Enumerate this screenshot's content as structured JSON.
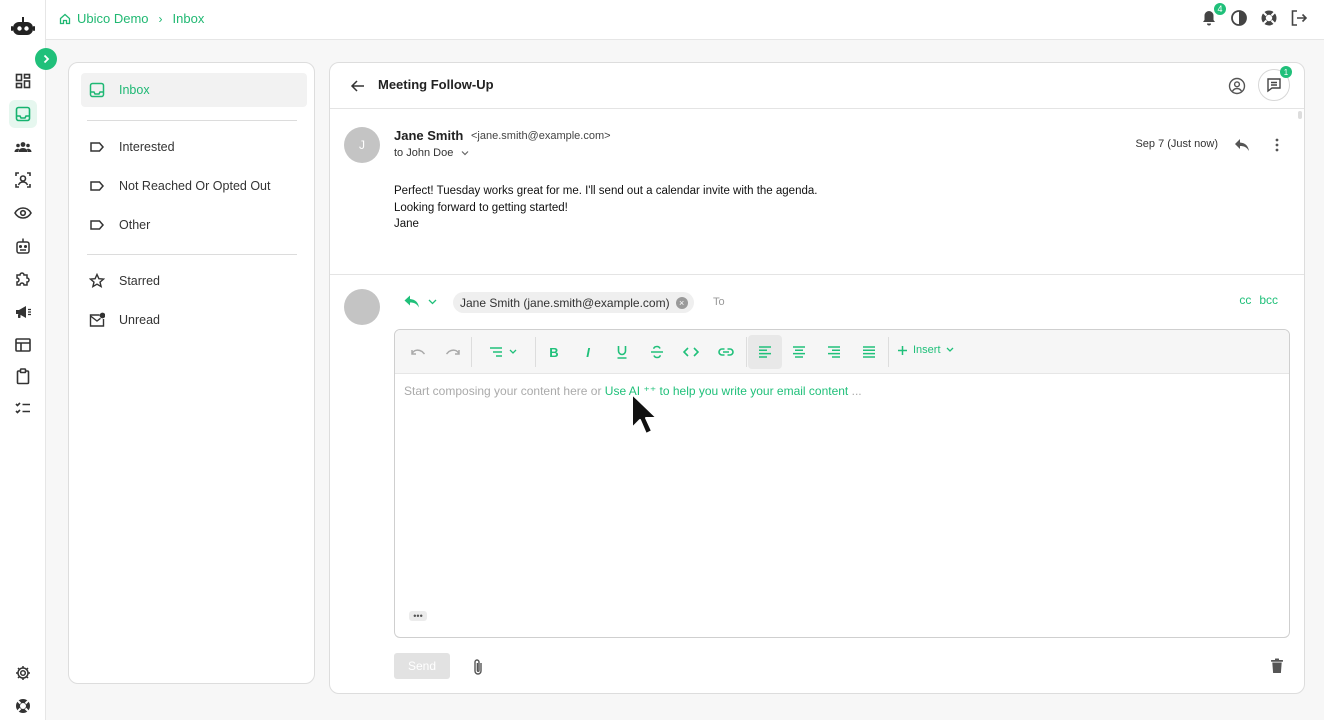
{
  "breadcrumb": {
    "workspace": "Ubico Demo",
    "current": "Inbox"
  },
  "notifications": {
    "count": "4"
  },
  "sidebar_icons": [
    "dashboard-icon",
    "inbox-icon",
    "contacts-icon",
    "prospects-icon",
    "eye-icon",
    "robot-icon",
    "extension-icon",
    "megaphone-icon",
    "table-icon",
    "clipboard-icon",
    "checklist-icon",
    "gear-icon",
    "lifebuoy-icon"
  ],
  "folders": {
    "inbox": "Inbox",
    "interested": "Interested",
    "not_reached": "Not Reached Or Opted Out",
    "other": "Other",
    "starred": "Starred",
    "unread": "Unread"
  },
  "thread": {
    "subject": "Meeting Follow-Up",
    "chat_badge": "1",
    "message": {
      "avatar_initial": "J",
      "sender_name": "Jane Smith",
      "sender_email": "<jane.smith@example.com>",
      "to": "to John Doe",
      "date": "Sep 7 (Just now)",
      "body": [
        "Perfect! Tuesday works great for me. I'll send out a calendar invite with the agenda.",
        "Looking forward to getting started!",
        "Jane"
      ]
    }
  },
  "compose": {
    "recipient": "Jane Smith (jane.smith@example.com)",
    "to_label": "To",
    "cc": "cc",
    "bcc": "bcc",
    "insert_label": "Insert",
    "placeholder_prefix": "Start composing your content here or",
    "placeholder_ai": "Use AI",
    "placeholder_suffix": "to help you write your email content",
    "placeholder_ellipsis": "...",
    "send_label": "Send"
  },
  "colors": {
    "accent": "#20c07a",
    "active_bg": "#e6f7ef"
  }
}
